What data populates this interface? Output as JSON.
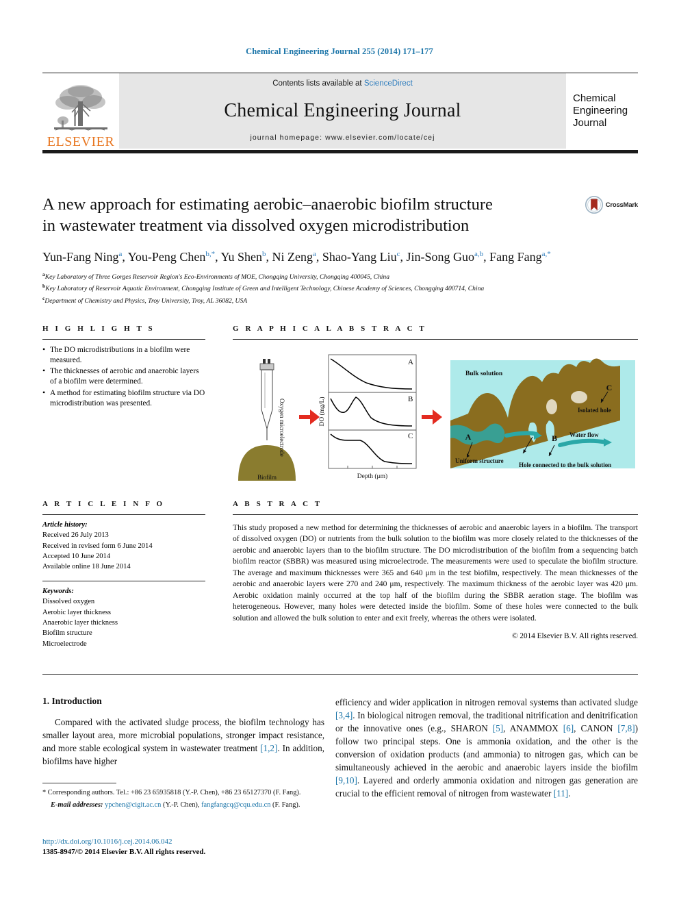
{
  "running_head": "Chemical Engineering Journal 255 (2014) 171–177",
  "masthead": {
    "contents_prefix": "Contents lists available at ",
    "sciencedirect": "ScienceDirect",
    "journal_title": "Chemical Engineering Journal",
    "homepage": "journal homepage: www.elsevier.com/locate/cej",
    "publisher": "ELSEVIER",
    "badge_line1": "Chemical",
    "badge_line2": "Engineering",
    "badge_line3": "Journal",
    "band_color": "#e6e6e6",
    "publisher_color": "#E87722",
    "link_color": "#2f7dbd"
  },
  "title": {
    "line1": "A new approach for estimating aerobic–anaerobic biofilm structure",
    "line2": "in wastewater treatment via dissolved oxygen microdistribution"
  },
  "crossmark": {
    "label": "CrossMark"
  },
  "authors": [
    {
      "name": "Yun-Fang Ning",
      "sup": "a",
      "sep": ", "
    },
    {
      "name": "You-Peng Chen",
      "sup": "b,*",
      "sep": ", "
    },
    {
      "name": "Yu Shen",
      "sup": "b",
      "sep": ", "
    },
    {
      "name": "Ni Zeng",
      "sup": "a",
      "sep": ", "
    },
    {
      "name": "Shao-Yang Liu",
      "sup": "c",
      "sep": ", "
    },
    {
      "name": "Jin-Song Guo",
      "sup": "a,b",
      "sep": ", "
    },
    {
      "name": "Fang Fang",
      "sup": "a,*",
      "sep": ""
    }
  ],
  "affiliations": [
    {
      "marker": "a",
      "text": "Key Laboratory of Three Gorges Reservoir Region's Eco-Environments of MOE, Chongqing University, Chongqing 400045, China"
    },
    {
      "marker": "b",
      "text": "Key Laboratory of Reservoir Aquatic Environment, Chongqing Institute of Green and Intelligent Technology, Chinese Academy of Sciences, Chongqing 400714, China"
    },
    {
      "marker": "c",
      "text": "Department of Chemistry and Physics, Troy University, Troy, AL 36082, USA"
    }
  ],
  "highlights": {
    "heading": "H I G H L I G H T S",
    "items": [
      "The DO microdistributions in a biofilm were measured.",
      "The thicknesses of aerobic and anaerobic layers of a biofilm were determined.",
      "A method for estimating biofilm structure via DO microdistribution was presented."
    ]
  },
  "graphical_abstract": {
    "heading": "G R A P H I C A L   A B S T R A C T",
    "probe_label": "Oxygen microelectrode",
    "biofilm_label": "Biofilm",
    "chart": {
      "y_axis_label": "DO (mg/L)",
      "x_axis_label": "Depth (μm)",
      "panels": [
        "A",
        "B",
        "C"
      ]
    },
    "schematic": {
      "bulk_solution": "Bulk solution",
      "uniform_structure": "Uniform structure",
      "hole_connected": "Hole connected to the bulk solution",
      "isolated_hole": "Isolated hole",
      "water_flow": "Water flow",
      "marker_a": "A",
      "marker_b": "B",
      "marker_c": "C",
      "biofilm_color": "#8a6d1f",
      "water_color": "#aeeaea",
      "flow_color": "#2aa8a8",
      "hole_color": "#e0d8c0"
    }
  },
  "article_info": {
    "heading": "A R T I C L E   I N F O",
    "history_label": "Article history:",
    "history": [
      "Received 26 July 2013",
      "Received in revised form 6 June 2014",
      "Accepted 10 June 2014",
      "Available online 18 June 2014"
    ],
    "keywords_label": "Keywords:",
    "keywords": [
      "Dissolved oxygen",
      "Aerobic layer thickness",
      "Anaerobic layer thickness",
      "Biofilm structure",
      "Microelectrode"
    ]
  },
  "abstract": {
    "heading": "A B S T R A C T",
    "text": "This study proposed a new method for determining the thicknesses of aerobic and anaerobic layers in a biofilm. The transport of dissolved oxygen (DO) or nutrients from the bulk solution to the biofilm was more closely related to the thicknesses of the aerobic and anaerobic layers than to the biofilm structure. The DO microdistribution of the biofilm from a sequencing batch biofilm reactor (SBBR) was measured using microelectrode. The measurements were used to speculate the biofilm structure. The average and maximum thicknesses were 365 and 640 μm in the test biofilm, respectively. The mean thicknesses of the aerobic and anaerobic layers were 270 and 240 μm, respectively. The maximum thickness of the aerobic layer was 420 μm. Aerobic oxidation mainly occurred at the top half of the biofilm during the SBBR aeration stage. The biofilm was heterogeneous. However, many holes were detected inside the biofilm. Some of these holes were connected to the bulk solution and allowed the bulk solution to enter and exit freely, whereas the others were isolated.",
    "copyright": "© 2014 Elsevier B.V. All rights reserved."
  },
  "introduction": {
    "heading": "1. Introduction",
    "left_para_pre": "Compared with the activated sludge process, the biofilm technology has smaller layout area, more microbial populations, stronger impact resistance, and more stable ecological system in wastewater treatment ",
    "left_ref1": "[1,2]",
    "left_para_post": ". In addition, biofilms have higher",
    "right_part1": "efficiency and wider application in nitrogen removal systems than activated sludge ",
    "right_ref1": "[3,4]",
    "right_part2": ". In biological nitrogen removal, the traditional nitrification and denitrification or the innovative ones (e.g., SHARON ",
    "right_ref2": "[5]",
    "right_part3": ", ANAMMOX ",
    "right_ref3": "[6]",
    "right_part4": ", CANON ",
    "right_ref4": "[7,8]",
    "right_part5": ") follow two principal steps. One is ammonia oxidation, and the other is the conversion of oxidation products (and ammonia) to nitrogen gas, which can be simultaneously achieved in the aerobic and anaerobic layers inside the biofilm ",
    "right_ref5": "[9,10]",
    "right_part6": ". Layered and orderly ammonia oxidation and nitrogen gas generation are crucial to the efficient removal of nitrogen from wastewater ",
    "right_ref6": "[11]",
    "right_part7": "."
  },
  "footnote": {
    "corresponding": "* Corresponding authors. Tel.: +86 23 65935818 (Y.-P. Chen), +86 23 65127370 (F. Fang).",
    "email_label": "E-mail addresses:",
    "email1": "ypchen@cigit.ac.cn",
    "email1_owner": "(Y.-P. Chen),",
    "email2": "fangfangcq@cqu.edu.cn",
    "email2_owner": "(F. Fang)."
  },
  "bottom": {
    "doi": "http://dx.doi.org/10.1016/j.cej.2014.06.042",
    "issn_copyright": "1385-8947/© 2014 Elsevier B.V. All rights reserved."
  }
}
